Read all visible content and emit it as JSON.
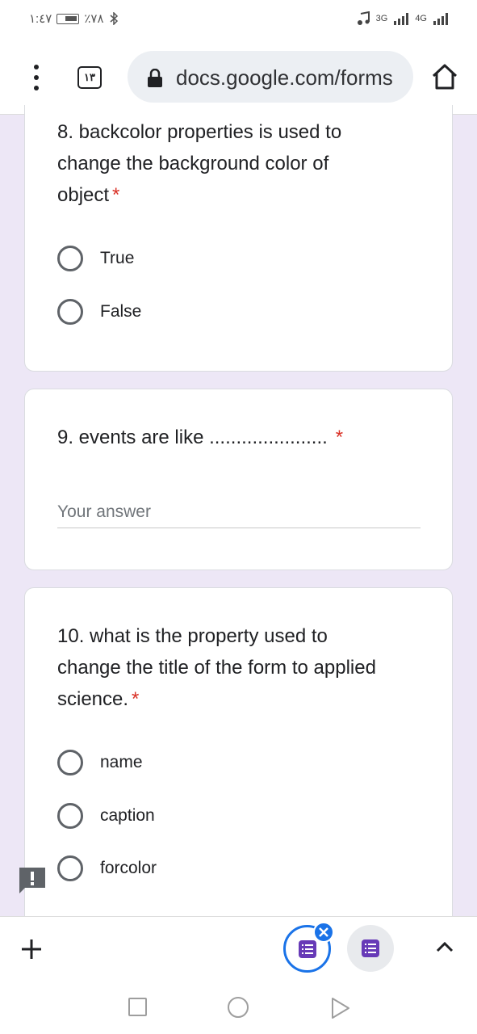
{
  "status_bar": {
    "time": "١:٤٧",
    "battery_percent": "٪٧٨",
    "net_1": "3G",
    "net_2": "4G"
  },
  "browser": {
    "tab_count": "١٣",
    "url": "docs.google.com/forms"
  },
  "questions": [
    {
      "text": "8. backcolor properties is used to change the background color of object",
      "required_mark": "*",
      "options": [
        "True",
        "False"
      ]
    },
    {
      "text": "9. events are like ......................",
      "required_mark": "*",
      "answer_placeholder": "Your answer"
    },
    {
      "text": "10. what is the property used to change the title of the form to applied science.",
      "required_mark": "*",
      "options": [
        "name",
        "caption",
        "forcolor"
      ]
    }
  ],
  "colors": {
    "background": "#ede7f6",
    "required": "#d93025",
    "accent": "#1a73e8",
    "forms_purple": "#673ab7"
  },
  "icons": {
    "feedback": "feedback-icon",
    "lock": "lock-icon",
    "home": "home-icon",
    "plus": "plus-icon"
  }
}
